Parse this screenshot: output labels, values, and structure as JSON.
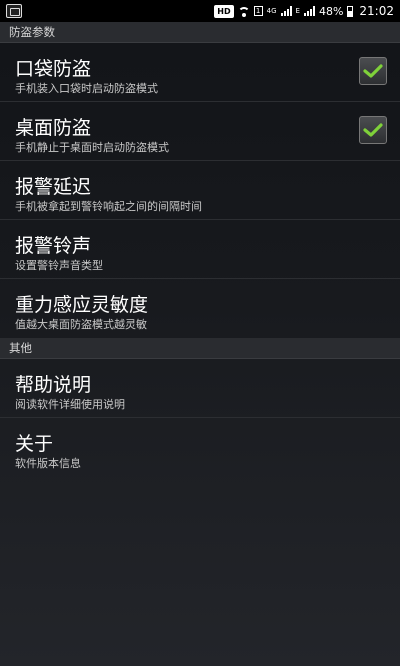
{
  "status_bar": {
    "hd": "HD",
    "sim_badge": "1",
    "network_4g": "4G",
    "network_e": "E",
    "battery": "48%",
    "time": "21:02"
  },
  "sections": [
    {
      "header": "防盗参数",
      "items": [
        {
          "title": "口袋防盗",
          "summary": "手机装入口袋时启动防盗模式",
          "checked": true
        },
        {
          "title": "桌面防盗",
          "summary": "手机静止于桌面时启动防盗模式",
          "checked": true
        },
        {
          "title": "报警延迟",
          "summary": "手机被拿起到警铃响起之间的间隔时间"
        },
        {
          "title": "报警铃声",
          "summary": "设置警铃声音类型"
        },
        {
          "title": "重力感应灵敏度",
          "summary": "值越大桌面防盗模式越灵敏"
        }
      ]
    },
    {
      "header": "其他",
      "items": [
        {
          "title": "帮助说明",
          "summary": "阅读软件详细使用说明"
        },
        {
          "title": "关于",
          "summary": "软件版本信息"
        }
      ]
    }
  ],
  "colors": {
    "check": "#7fd13a",
    "background": "#17191d"
  },
  "icons": {
    "app": "anti-theft-app-icon",
    "check": "checkmark-icon"
  }
}
